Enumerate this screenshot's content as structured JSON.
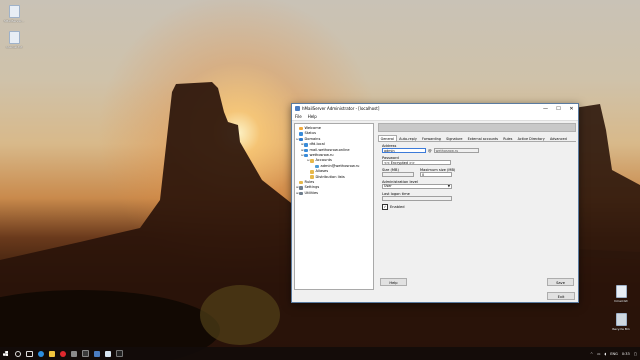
{
  "desktop": {
    "icons": [
      {
        "label": "hMailServer...",
        "icon": "app-icon"
      },
      {
        "label": "openssl.txt",
        "icon": "text-file-icon"
      },
      {
        "label": "hmail.txt",
        "icon": "text-file-icon"
      },
      {
        "label": "Recycle Bin",
        "icon": "recycle-bin-icon"
      }
    ]
  },
  "window": {
    "title": "hMailServer Administrator - [localhost]",
    "controls": {
      "minimize": "—",
      "maximize": "☐",
      "close": "✕"
    },
    "menu": [
      "File",
      "Help"
    ],
    "tree": [
      {
        "label": "Welcome",
        "color": "#f2a93b"
      },
      {
        "label": "Status",
        "color": "#3a8bd8"
      },
      {
        "label": "Domains",
        "color": "#2e7bcf"
      },
      {
        "label": "dfd.local",
        "color": "#3a8bd8"
      },
      {
        "label": "mail.wethosrow.online",
        "color": "#3a8bd8"
      },
      {
        "label": "wethosrow.ru",
        "color": "#3a8bd8"
      },
      {
        "label": "Accounts",
        "color": "#e6b84a"
      },
      {
        "label": "admin@wethosrow.ru",
        "color": "#4a9ad6"
      },
      {
        "label": "Aliases",
        "color": "#e6b84a"
      },
      {
        "label": "Distribution lists",
        "color": "#e6b84a"
      },
      {
        "label": "Rules",
        "color": "#e6b84a"
      },
      {
        "label": "Settings",
        "color": "#6e7d8c"
      },
      {
        "label": "Utilities",
        "color": "#6e7d8c"
      }
    ],
    "tabs": [
      "General",
      "Auto-reply",
      "Forwarding",
      "Signature",
      "External accounts",
      "Rules",
      "Active Directory",
      "Advanced"
    ],
    "active_tab": "General",
    "form": {
      "address_label": "Address",
      "address_value": "admin",
      "at_sign": "@",
      "domain_value": "wethosrow.ru",
      "password_label": "Password",
      "password_value": "<< Encrypted >>",
      "size_label": "Size (MB)",
      "size_value": "",
      "max_size_label": "Maximum size (MB)",
      "max_size_value": "0",
      "admin_level_label": "Administration level",
      "admin_level_value": "User",
      "last_logon_label": "Last logon time",
      "last_logon_value": "",
      "enabled_label": "Enabled",
      "enabled": true
    },
    "buttons": {
      "help": "Help",
      "save": "Save",
      "exit": "Exit"
    }
  },
  "taskbar": {
    "language": "ENG",
    "time": "0:33"
  }
}
